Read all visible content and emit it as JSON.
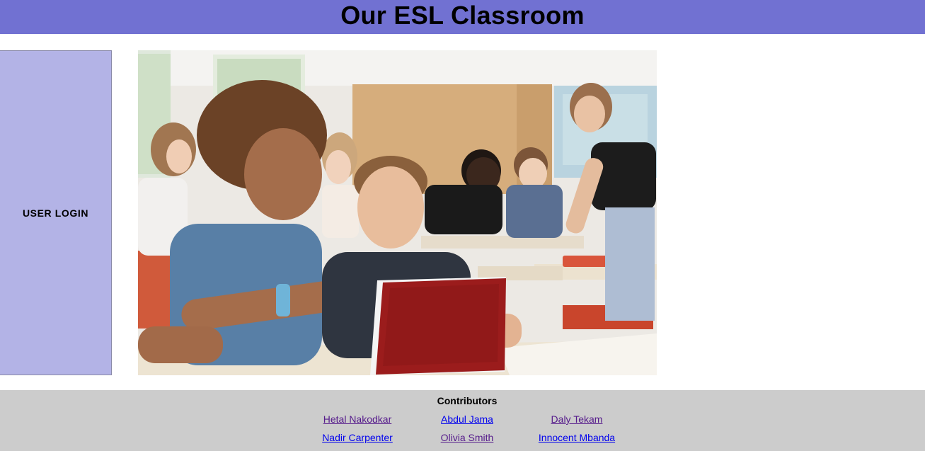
{
  "header": {
    "title": "Our ESL Classroom",
    "bg_color": "#7171d2"
  },
  "sidebar": {
    "login_label": "USER LOGIN",
    "bg_color": "#b3b3e6"
  },
  "hero": {
    "description_icon": "classroom-photo"
  },
  "footer": {
    "title": "Contributors",
    "bg_color": "#cccccc",
    "contributors": [
      {
        "name": "Hetal Nakodkar",
        "visited": true
      },
      {
        "name": "Abdul Jama",
        "visited": false
      },
      {
        "name": "Daly Tekam",
        "visited": true
      },
      {
        "name": "Nadir Carpenter",
        "visited": false
      },
      {
        "name": "Olivia Smith",
        "visited": true
      },
      {
        "name": "Innocent Mbanda",
        "visited": false
      }
    ]
  }
}
